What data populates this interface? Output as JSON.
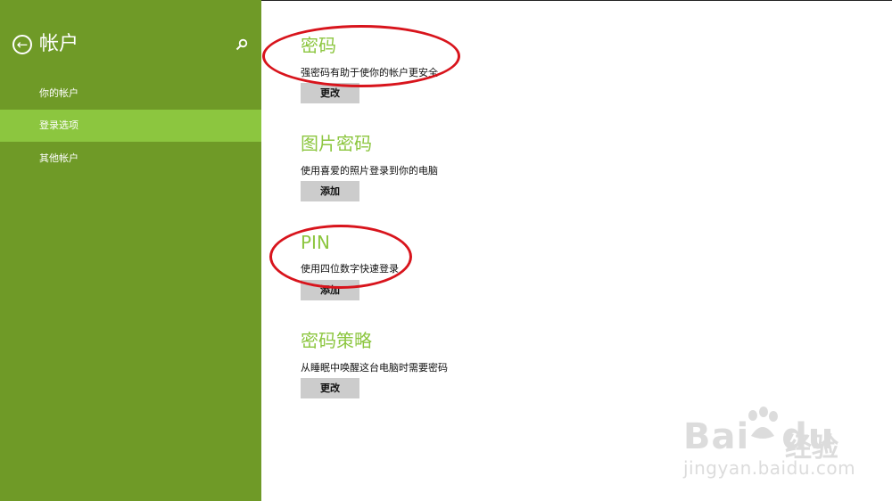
{
  "sidebar": {
    "title": "帐户",
    "items": [
      {
        "label": "你的帐户"
      },
      {
        "label": "登录选项"
      },
      {
        "label": "其他帐户"
      }
    ]
  },
  "sections": [
    {
      "title": "密码",
      "description": "强密码有助于使你的帐户更安全",
      "button": "更改"
    },
    {
      "title": "图片密码",
      "description": "使用喜爱的照片登录到你的电脑",
      "button": "添加"
    },
    {
      "title": "PIN",
      "description": "使用四位数字快速登录",
      "button": "添加"
    },
    {
      "title": "密码策略",
      "description": "从睡眠中唤醒这台电脑时需要密码",
      "button": "更改"
    }
  ],
  "watermark": {
    "brand": "Bai",
    "brand2": "du",
    "product": "经验",
    "url": "jingyan.baidu.com"
  },
  "colors": {
    "sidebar": "#6f9a27",
    "selected": "#8cc63f",
    "accent": "#8cc63f",
    "annotation": "#d8141c"
  }
}
